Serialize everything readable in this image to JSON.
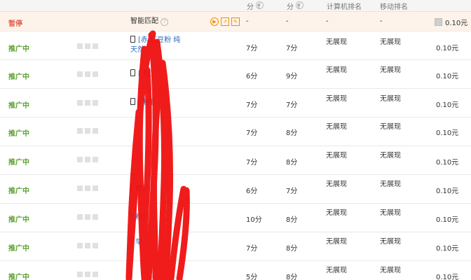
{
  "header": {
    "col_score1": "分",
    "col_score2": "分",
    "col_pc_rank": "计算机排名",
    "col_mobile_rank": "移动排名"
  },
  "rows": [
    {
      "status": "暂停",
      "keyword": "智能匹配",
      "score1": "-",
      "score2": "-",
      "pc_rank": "-",
      "mobile_rank": "-",
      "bid": "0.10元",
      "paused": true
    },
    {
      "status": "推广中",
      "keyword": "[赤 红豆粉 纯",
      "keyword2": "天然",
      "score1": "7分",
      "score2": "7分",
      "pc_rank": "无展现",
      "mobile_rank": "无展现",
      "bid": "0.10元"
    },
    {
      "status": "推广中",
      "keyword": "[ 粉]",
      "score1": "6分",
      "score2": "9分",
      "pc_rank": "无展现",
      "mobile_rank": "无展现",
      "bid": "0.10元"
    },
    {
      "status": "推广中",
      "keyword": "[ 粉]",
      "score1": "7分",
      "score2": "7分",
      "pc_rank": "无展现",
      "mobile_rank": "无展现",
      "bid": "0.10元"
    },
    {
      "status": "推广中",
      "keyword": "",
      "score1": "7分",
      "score2": "8分",
      "pc_rank": "无展现",
      "mobile_rank": "无展现",
      "bid": "0.10元"
    },
    {
      "status": "推广中",
      "keyword": "",
      "score1": "7分",
      "score2": "8分",
      "pc_rank": "无展现",
      "mobile_rank": "无展现",
      "bid": "0.10元"
    },
    {
      "status": "推广中",
      "keyword": "[ 粉]",
      "score1": "6分",
      "score2": "7分",
      "pc_rank": "无展现",
      "mobile_rank": "无展现",
      "bid": "0.10元"
    },
    {
      "status": "推广中",
      "keyword": "[ 粉]",
      "score1": "10分",
      "score2": "8分",
      "pc_rank": "无展现",
      "mobile_rank": "无展现",
      "bid": "0.10元"
    },
    {
      "status": "推广中",
      "keyword": "[ 早",
      "score1": "7分",
      "score2": "8分",
      "pc_rank": "无展现",
      "mobile_rank": "无展现",
      "bid": "0.10元"
    },
    {
      "status": "推广中",
      "keyword": "[",
      "score1": "5分",
      "score2": "8分",
      "pc_rank": "无展现",
      "mobile_rank": "无展现",
      "bid": "0.10元"
    }
  ],
  "colors": {
    "active_status": "#5ca02f",
    "paused_status": "#e0604a",
    "paused_row_bg": "#fdf3ea",
    "keyword_link": "#2e6dbf",
    "scribble": "#f01010"
  },
  "icons": [
    "help-icon",
    "up-arrow-icon",
    "phone-icon",
    "play-icon",
    "trend-chart-icon",
    "edit-icon"
  ]
}
